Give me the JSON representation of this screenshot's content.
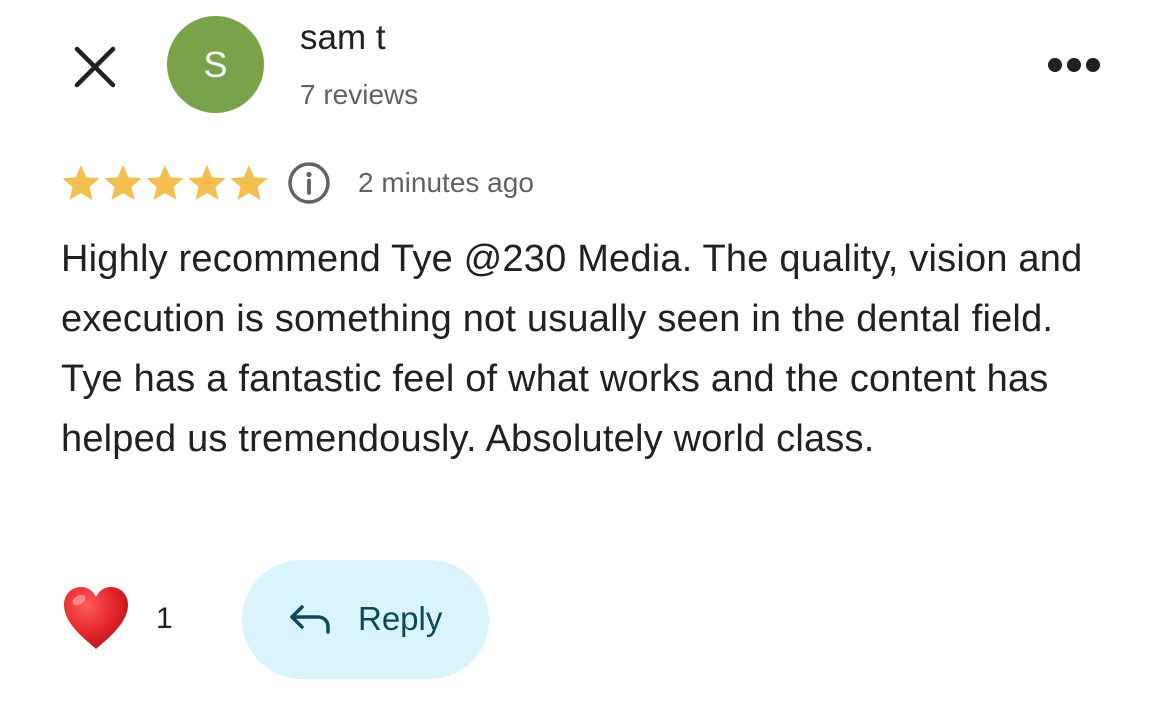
{
  "author": {
    "initial": "S",
    "name": "sam t",
    "reviews": "7 reviews",
    "avatar_color": "#79a34b"
  },
  "review": {
    "rating": 5,
    "rating_max": 5,
    "star_color": "#f4bf4f",
    "timestamp": "2 minutes ago",
    "text": "Highly recommend Tye @230 Media. The quality, vision and execution is something not usually seen in the dental field. Tye has a fantastic feel of what works and the content has helped us tremendously. Absolutely world class."
  },
  "actions": {
    "reaction_icon": "heart-icon",
    "reaction_count": "1",
    "reply_label": "Reply",
    "reply_bg_color": "#d9f4fd"
  },
  "icons": {
    "close": "close-icon",
    "more": "more-horizontal-icon",
    "info": "info-icon",
    "reply": "reply-arrow-icon"
  }
}
